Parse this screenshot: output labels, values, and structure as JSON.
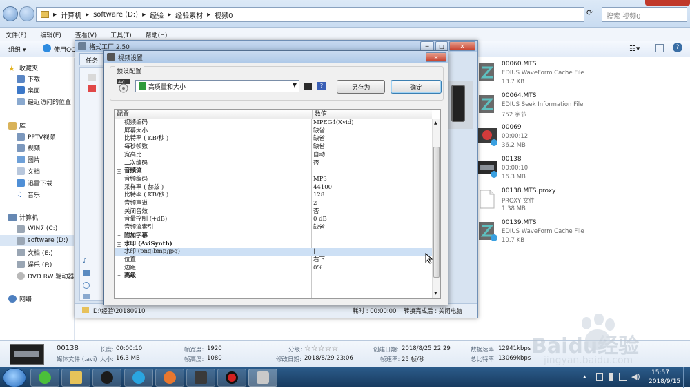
{
  "explorer": {
    "breadcrumb": [
      "计算机",
      "software (D:)",
      "经验",
      "经验素材",
      "视频0"
    ],
    "search_placeholder": "搜索 视频0",
    "menu": [
      "文件(F)",
      "编辑(E)",
      "查看(V)",
      "工具(T)",
      "帮助(H)"
    ],
    "toolbar": {
      "organize": "组织 ▾",
      "use_qq": "使用QQ"
    },
    "sidebar": {
      "favorites": {
        "title": "收藏夹",
        "items": [
          "下载",
          "桌面",
          "最近访问的位置"
        ]
      },
      "library": {
        "title": "库",
        "items": [
          "PPTV视频",
          "视频",
          "图片",
          "文档",
          "迅雷下载",
          "音乐"
        ]
      },
      "computer": {
        "title": "计算机",
        "items": [
          "WIN7 (C:)",
          "software (D:)",
          "文档 (E:)",
          "娱乐 (F:)",
          "DVD RW 驱动器"
        ]
      },
      "network": "网络"
    },
    "files": [
      {
        "name": "00060.MTS",
        "line1": "EDIUS WaveForm Cache File",
        "line2": "13.7 KB"
      },
      {
        "name": "00064.MTS",
        "line1": "EDIUS Seek Information File",
        "line2": "752 字节"
      },
      {
        "name": "00069",
        "line1": "00:00:12",
        "line2": "36.2 MB"
      },
      {
        "name": "00138",
        "line1": "00:00:10",
        "line2": "16.3 MB"
      },
      {
        "name": "00138.MTS.proxy",
        "line1": "PROXY 文件",
        "line2": "1.38 MB"
      },
      {
        "name": "00139.MTS",
        "line1": "EDIUS WaveForm Cache File",
        "line2": "10.7 KB"
      }
    ],
    "details": {
      "name": "00138",
      "type": "媒体文件 (.avi)",
      "length_label": "长度:",
      "length": "00:00:10",
      "size_label": "大小:",
      "size": "16.3 MB",
      "frame_width_label": "帧宽度:",
      "frame_width": "1920",
      "frame_height_label": "帧高度:",
      "frame_height": "1080",
      "rating_label": "分级:",
      "rating_stars": "☆☆☆☆☆",
      "modified_label": "修改日期:",
      "modified": "2018/8/29 23:06",
      "created_label": "创建日期:",
      "created": "2018/8/25 22:29",
      "framerate_label": "帧速率:",
      "framerate": "25 帧/秒",
      "datarate_label": "数据速率:",
      "datarate": "12941kbps",
      "bitrate_label": "总比特率:",
      "bitrate": "13069kbps"
    }
  },
  "ff_window": {
    "title": "格式工厂 2.50",
    "tab": "任务",
    "status_left": "D:\\经验\\20180910",
    "status_mid": "耗时 : 00:00:00",
    "status_right": "转换完成后 : 关闭电脑"
  },
  "dialog": {
    "title": "视频设置",
    "preset_group": "预设配置",
    "preset_value": "高质量和大小",
    "save_as": "另存为",
    "ok": "确定",
    "help": "?",
    "headers": {
      "config": "配置",
      "value": "数值"
    },
    "rows": [
      {
        "k": "视频编码",
        "v": "MPEG4(Xvid)"
      },
      {
        "k": "屏幕大小",
        "v": "缺省"
      },
      {
        "k": "比特率 ( KB/秒 )",
        "v": "缺省"
      },
      {
        "k": "每秒帧数",
        "v": "缺省"
      },
      {
        "k": "宽高比",
        "v": "自动"
      },
      {
        "k": "二次编码",
        "v": "否"
      },
      {
        "k": "音频流",
        "v": "",
        "section": "minus"
      },
      {
        "k": "音频编码",
        "v": "MP3"
      },
      {
        "k": "采样率 ( 赫兹 )",
        "v": "44100"
      },
      {
        "k": "比特率 ( KB/秒 )",
        "v": "128"
      },
      {
        "k": "音频声道",
        "v": "2"
      },
      {
        "k": "关闭音效",
        "v": "否"
      },
      {
        "k": "音量控制 (+dB)",
        "v": "0 dB"
      },
      {
        "k": "音频流索引",
        "v": "缺省"
      },
      {
        "k": "附加字幕",
        "v": "",
        "section": "plus"
      },
      {
        "k": "水印 (AviSynth)",
        "v": "",
        "section": "minus"
      },
      {
        "k": "水印 (png;bmp;jpg)",
        "v": "|",
        "selected": true
      },
      {
        "k": "位置",
        "v": "右下"
      },
      {
        "k": "边距",
        "v": "0%"
      },
      {
        "k": "高级",
        "v": "",
        "section": "plus"
      }
    ]
  },
  "tray": {
    "time": "15:57",
    "date": "2018/9/15"
  },
  "watermark": {
    "brand": "Baidu经验",
    "url": "jingyan.baidu.com"
  },
  "colors": {
    "accent": "#3a6ea5",
    "selection": "#cde0f5",
    "taskbar": "#1f4a74"
  }
}
